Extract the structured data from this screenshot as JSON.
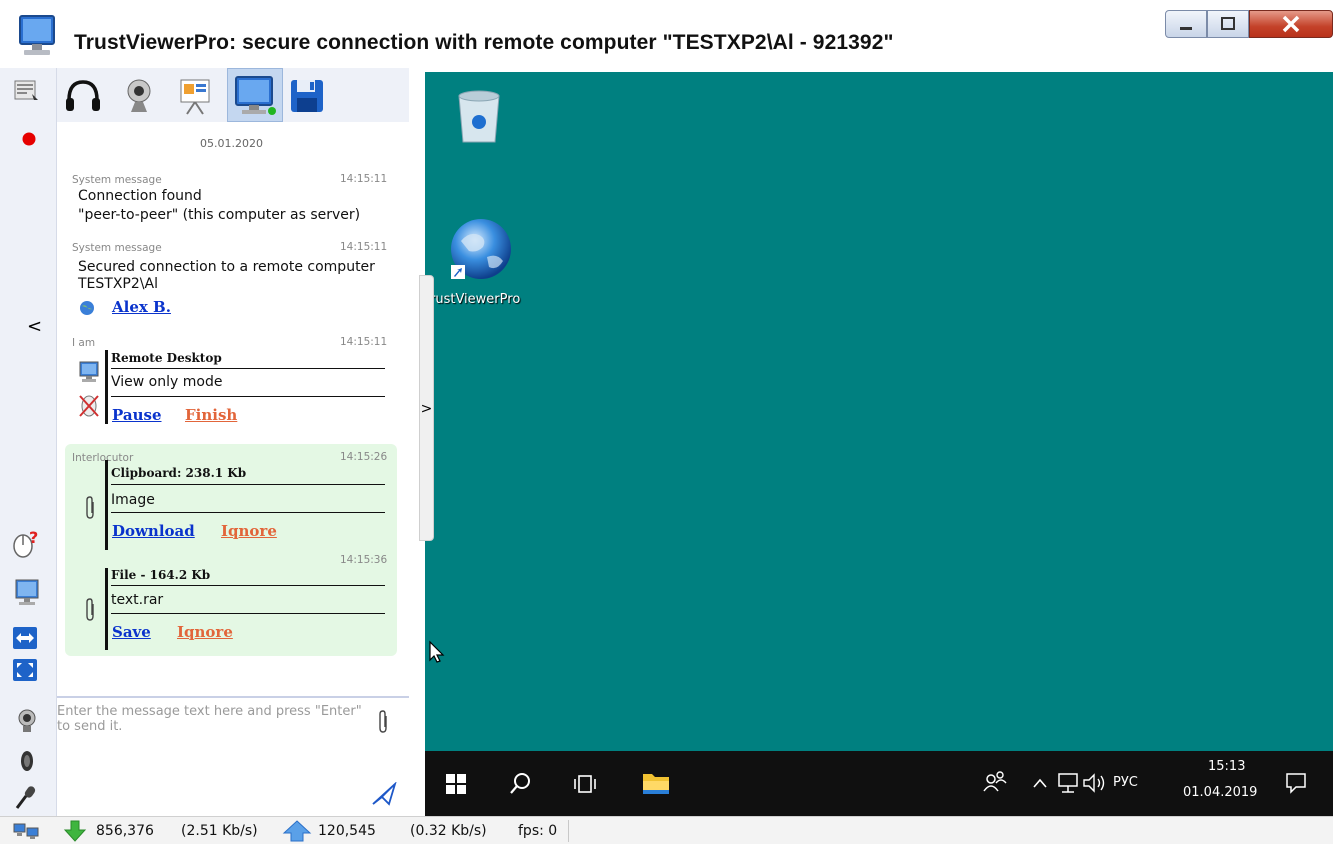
{
  "window": {
    "title": "TrustViewerPro: secure connection with remote computer \"TESTXP2\\Al - 921392\""
  },
  "toolbar": {
    "icons": [
      "headset-icon",
      "webcam-icon",
      "presentation-icon",
      "remote-screen-icon",
      "save-disk-icon"
    ]
  },
  "chat": {
    "date": "05.01.2020",
    "messages": [
      {
        "sender": "System message",
        "time": "14:15:11",
        "line1": "Connection found",
        "line2": "\"peer-to-peer\" (this computer as server)"
      },
      {
        "sender": "System message",
        "time": "14:15:11",
        "line1": "Secured connection to a remote computer",
        "line2": "TESTXP2\\Al",
        "user_link": "Alex B."
      },
      {
        "sender": "I am",
        "time": "14:15:11",
        "block_title": "Remote Desktop",
        "block_value": "View only mode",
        "action1": "Pause",
        "action2": "Finish"
      },
      {
        "sender": "Interlocutor",
        "time": "14:15:26",
        "block_title": "Clipboard: 238.1 Kb",
        "block_value": "Image",
        "action1": "Download",
        "action2": "Iqnore"
      },
      {
        "time": "14:15:36",
        "block_title": "File - 164.2 Kb",
        "block_value": "text.rar",
        "action1": "Save",
        "action2": "Iqnore"
      }
    ]
  },
  "input": {
    "placeholder": "Enter the message text here and press \"Enter\" to send it."
  },
  "sidebar": {
    "collapse_glyph": "<",
    "expand_glyph": ">"
  },
  "remote_desktop": {
    "shortcut_label": "rustViewerPro",
    "taskbar": {
      "language": "РУС",
      "time": "15:13",
      "date": "01.04.2019"
    },
    "colors": {
      "desktop": "#008080",
      "taskbar": "#101010"
    }
  },
  "status": {
    "download_bytes": "856,376",
    "download_rate": "(2.51 Kb/s)",
    "upload_bytes": "120,545",
    "upload_rate": "(0.32 Kb/s)",
    "fps": "fps: 0"
  }
}
